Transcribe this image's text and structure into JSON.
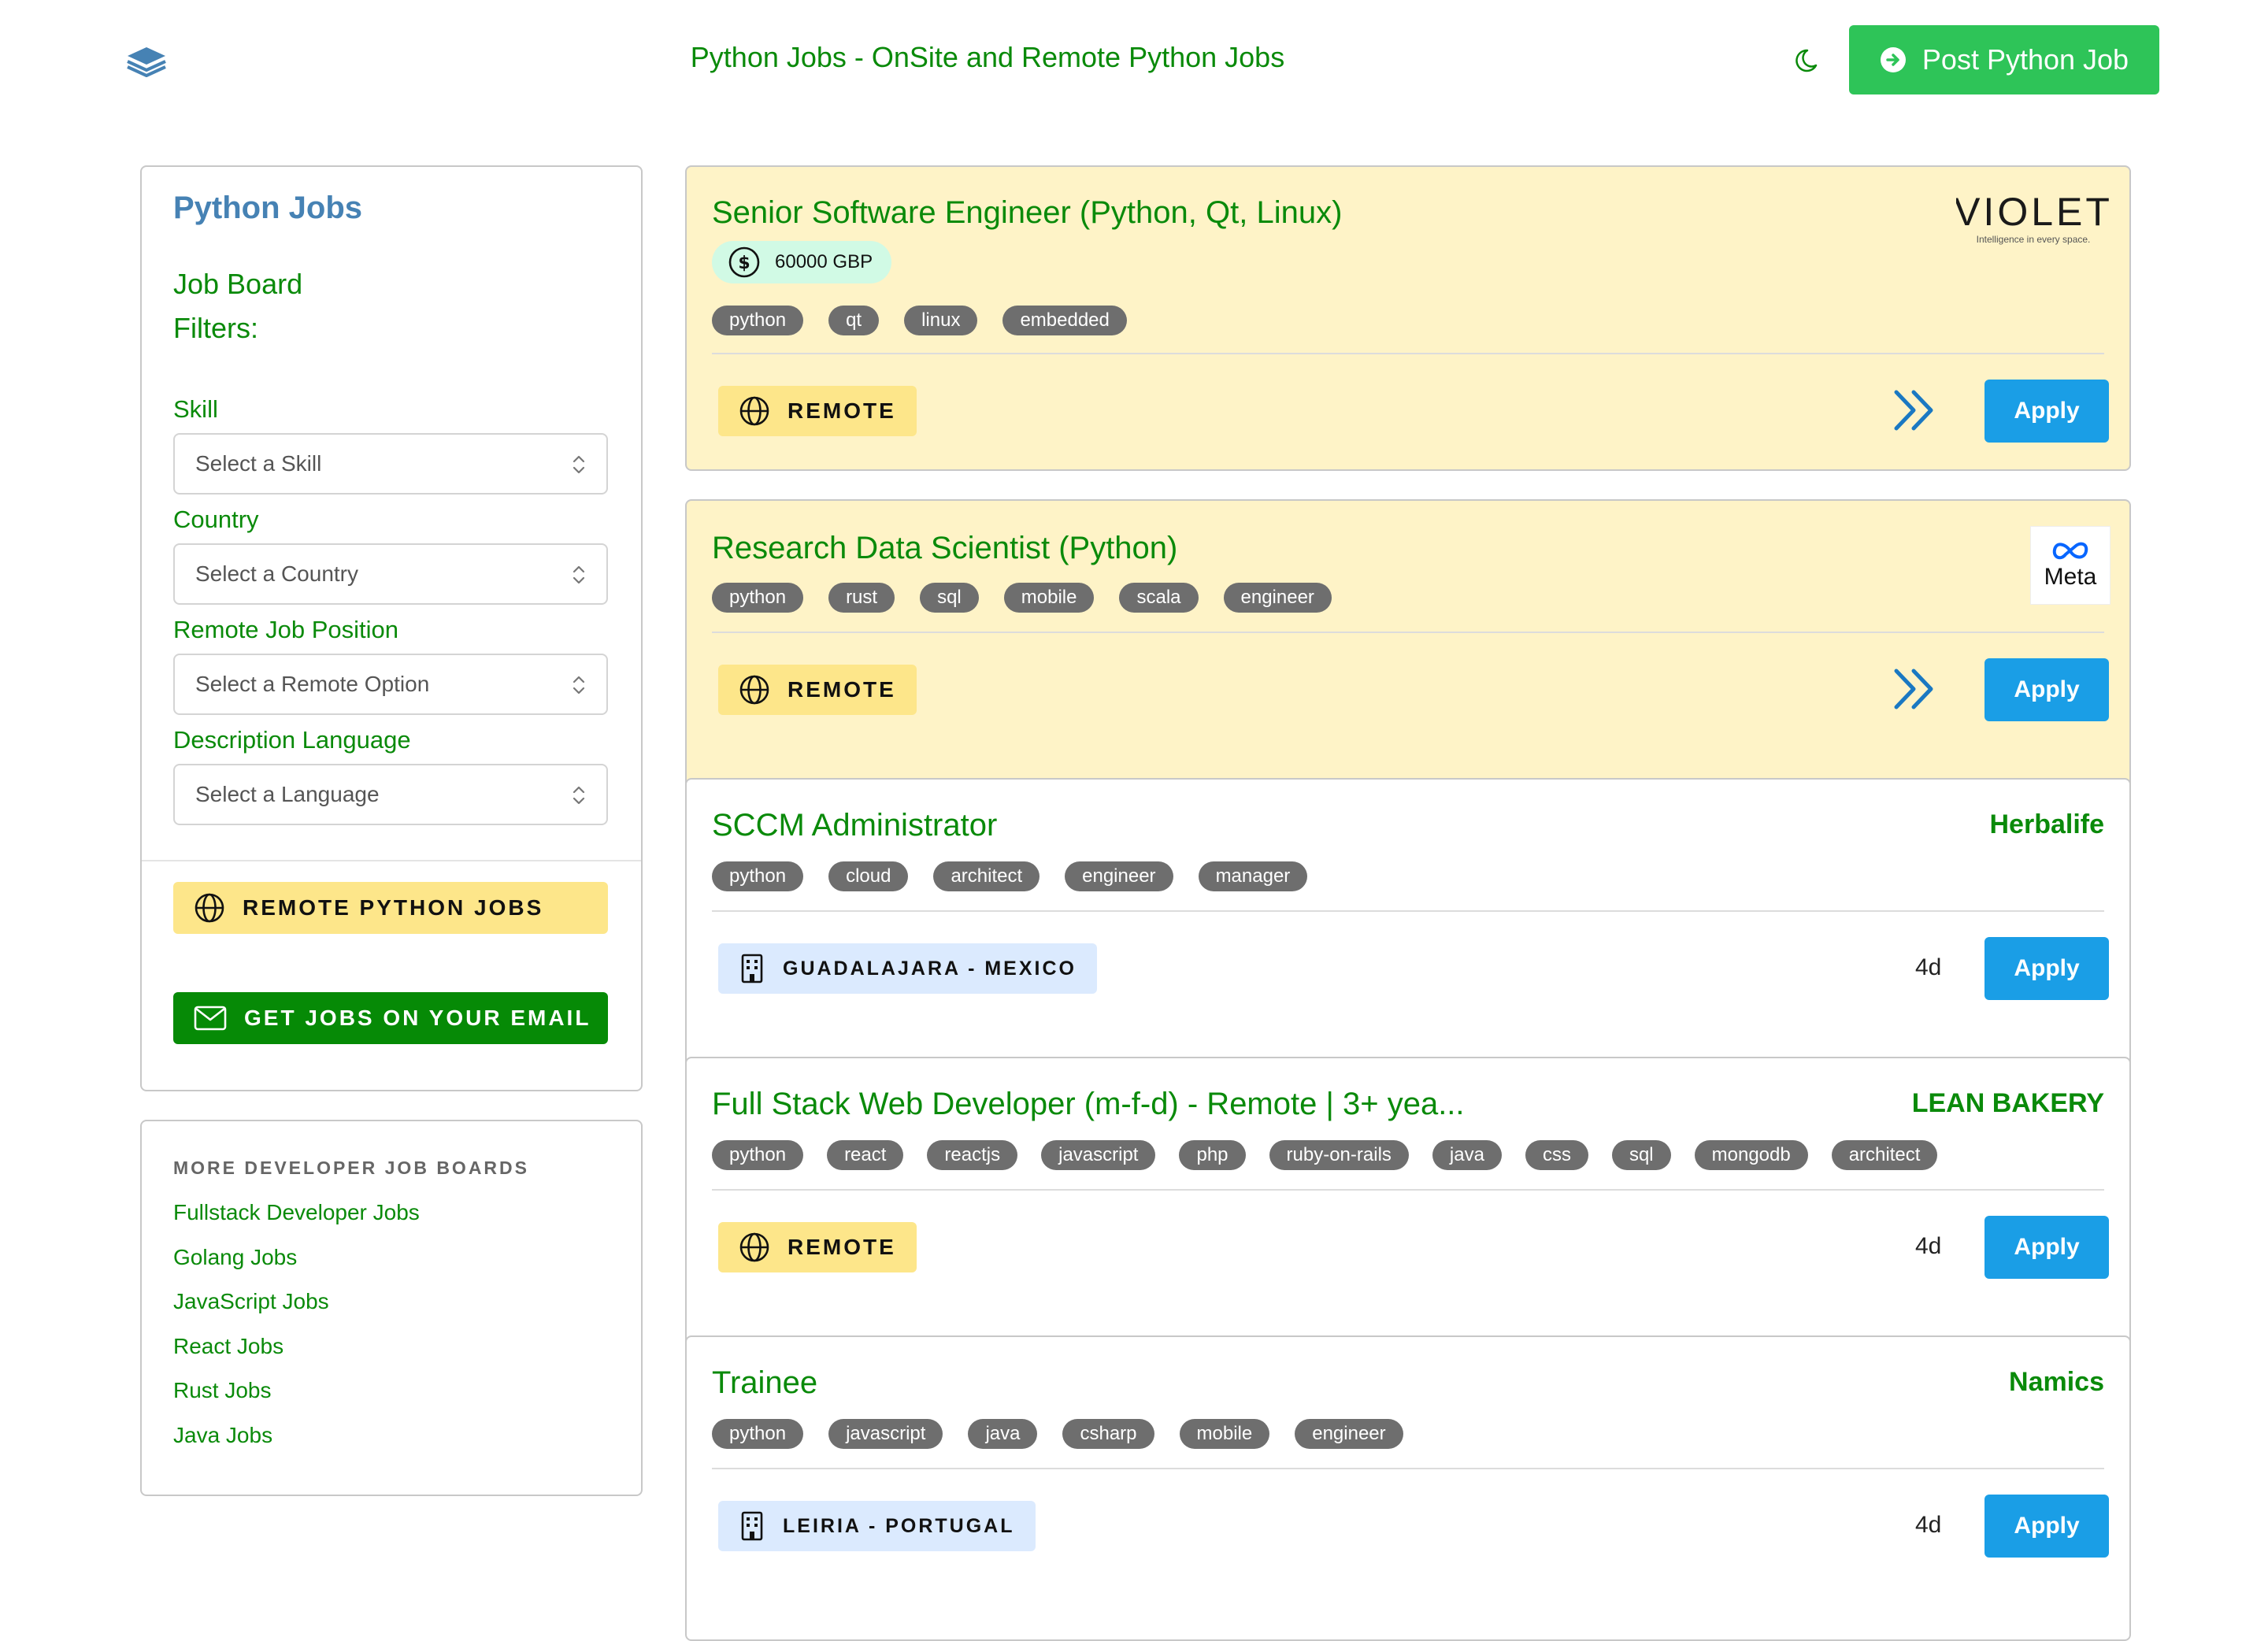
{
  "header": {
    "site_title": "Python Jobs - OnSite and Remote Python Jobs",
    "post_button": "Post Python Job",
    "icons": [
      "layers-icon",
      "moon-icon",
      "arrow-right-circle-icon"
    ]
  },
  "sidebar": {
    "title": "Python Jobs",
    "subtitle": "Job Board",
    "filters_heading": "Filters:",
    "filters": [
      {
        "label": "Skill",
        "placeholder": "Select a Skill"
      },
      {
        "label": "Country",
        "placeholder": "Select a Country"
      },
      {
        "label": "Remote Job Position",
        "placeholder": "Select a Remote Option"
      },
      {
        "label": "Description Language",
        "placeholder": "Select a Language"
      }
    ],
    "remote_jobs_button": "REMOTE PYTHON JOBS",
    "email_button": "GET JOBS ON YOUR EMAIL"
  },
  "more_boards": {
    "heading": "MORE DEVELOPER JOB BOARDS",
    "links": [
      "Fullstack Developer Jobs",
      "Golang Jobs",
      "JavaScript Jobs",
      "React Jobs",
      "Rust Jobs",
      "Java Jobs"
    ]
  },
  "jobs": [
    {
      "title": "Senior Software Engineer (Python, Qt, Linux)",
      "salary": "60000 GBP",
      "tags": [
        "python",
        "qt",
        "linux",
        "embedded"
      ],
      "location": "REMOTE",
      "apply": "Apply",
      "company_logo_text": "VIOLET",
      "company_logo_tagline": "Intelligence in every space."
    },
    {
      "title": "Research Data Scientist (Python)",
      "tags": [
        "python",
        "rust",
        "sql",
        "mobile",
        "scala",
        "engineer"
      ],
      "location": "REMOTE",
      "apply": "Apply",
      "company_logo_text": "Meta"
    },
    {
      "title": "SCCM Administrator",
      "company": "Herbalife",
      "tags": [
        "python",
        "cloud",
        "architect",
        "engineer",
        "manager"
      ],
      "location": "GUADALAJARA - MEXICO",
      "age": "4d",
      "apply": "Apply"
    },
    {
      "title": "Full Stack Web Developer (m-f-d) - Remote | 3+ yea...",
      "company": "LEAN BAKERY",
      "tags": [
        "python",
        "react",
        "reactjs",
        "javascript",
        "php",
        "ruby-on-rails",
        "java",
        "css",
        "sql",
        "mongodb",
        "architect"
      ],
      "location": "REMOTE",
      "age": "4d",
      "apply": "Apply"
    },
    {
      "title": "Trainee",
      "company": "Namics",
      "tags": [
        "python",
        "javascript",
        "java",
        "csharp",
        "mobile",
        "engineer"
      ],
      "location": "LEIRIA - PORTUGAL",
      "age": "4d",
      "apply": "Apply"
    }
  ]
}
